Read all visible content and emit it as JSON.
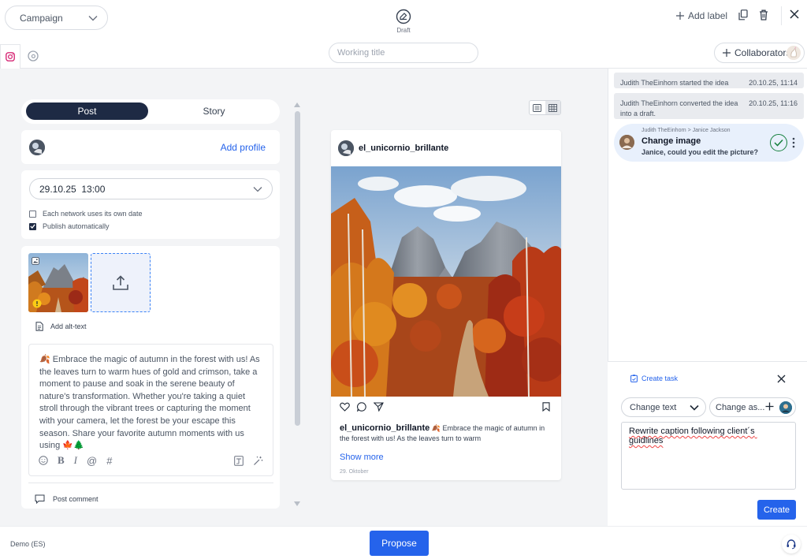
{
  "header": {
    "campaign_label": "Campaign",
    "status_label": "Draft",
    "add_label": "Add label"
  },
  "subbar": {
    "title_placeholder": "Working title",
    "collaborators_label": "Collaborators"
  },
  "editor": {
    "tabs": {
      "post": "Post",
      "story": "Story"
    },
    "add_profile": "Add profile",
    "date_value": "29.10.25  13:00",
    "checkbox_own_date": "Each network uses its own date",
    "checkbox_own_date_checked": false,
    "checkbox_publish": "Publish automatically",
    "checkbox_publish_checked": true,
    "add_alt_text": "Add alt-text",
    "caption": "🍂 Embrace the magic of autumn in the forest with us! As the leaves turn to warm hues of gold and crimson, take a moment to pause and soak in the serene beauty of nature's transformation. Whether you're taking a quiet stroll through the vibrant trees or capturing the moment with your camera, let the forest be your escape this season. Share your favorite autumn moments with us using 🍁🌲",
    "post_comment": "Post comment"
  },
  "preview": {
    "username": "el_unicornio_brillante",
    "caption_user": "el_unicornio_brillante",
    "caption_text": "🍂 Embrace the magic of autumn in the forest with us! As the leaves turn to warm",
    "show_more": "Show more",
    "date": "29. Oktober"
  },
  "activity": [
    {
      "text": "Judith TheEinhorn started the idea",
      "time": "20.10.25, 11:14"
    },
    {
      "text": "Judith TheEinhorn converted the idea into a draft.",
      "time": "20.10.25, 11:16"
    }
  ],
  "task": {
    "meta": "Judith TheEinhorn > Janice Jackson",
    "title": "Change image",
    "description": "Janice, could you edit the picture?"
  },
  "create_task": {
    "header": "Create task",
    "type_value": "Change text",
    "assignee_value": "Change as...",
    "text": "Rewrite caption following client´s guidlines",
    "create_button": "Create"
  },
  "footer": {
    "workspace": "Demo (ES)",
    "propose_button": "Propose"
  },
  "colors": {
    "accent": "#2563eb",
    "dark_tab": "#1e2a44",
    "instagram": "#d62976",
    "success": "#15803d"
  }
}
